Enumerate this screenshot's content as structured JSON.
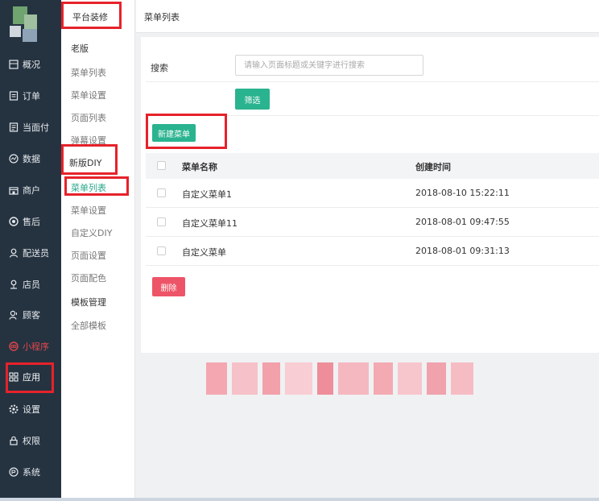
{
  "leftnav": {
    "items": [
      {
        "label": "概况",
        "icon": "overview-icon"
      },
      {
        "label": "订单",
        "icon": "order-icon"
      },
      {
        "label": "当面付",
        "icon": "face-pay-icon"
      },
      {
        "label": "数据",
        "icon": "data-icon"
      },
      {
        "label": "商户",
        "icon": "shop-icon"
      },
      {
        "label": "售后",
        "icon": "after-sales-icon"
      },
      {
        "label": "配送员",
        "icon": "courier-icon"
      },
      {
        "label": "店员",
        "icon": "clerk-icon"
      },
      {
        "label": "顾客",
        "icon": "customer-icon"
      },
      {
        "label": "小程序",
        "icon": "mini-program-icon"
      },
      {
        "label": "应用",
        "icon": "apps-icon"
      },
      {
        "label": "设置",
        "icon": "settings-icon"
      },
      {
        "label": "权限",
        "icon": "permission-icon"
      },
      {
        "label": "系统",
        "icon": "system-icon"
      }
    ]
  },
  "subnav": {
    "header": "平台装修",
    "old_group": "老版",
    "old_items": [
      "菜单列表",
      "菜单设置",
      "页面列表",
      "弹幕设置"
    ],
    "new_group": "新版DIY",
    "new_items": [
      "菜单列表",
      "菜单设置",
      "自定义DIY",
      "页面设置",
      "页面配色"
    ],
    "template_group": "模板管理",
    "template_items": [
      "全部模板"
    ]
  },
  "topbar": {
    "title": "菜单列表"
  },
  "search": {
    "label": "搜索",
    "placeholder": "请输入页面标题或关键字进行搜索",
    "value": ""
  },
  "buttons": {
    "filter": "筛选",
    "new_menu": "新建菜单",
    "delete": "删除"
  },
  "table": {
    "headers": {
      "name": "菜单名称",
      "time": "创建时间"
    },
    "rows": [
      {
        "name": "自定义菜单1",
        "time": "2018-08-10 15:22:11"
      },
      {
        "name": "自定义菜单11",
        "time": "2018-08-01 09:47:55"
      },
      {
        "name": "自定义菜单",
        "time": "2018-08-01 09:31:13"
      }
    ]
  },
  "colors": {
    "sidebar_bg": "#253341",
    "accent_green": "#2ab38f",
    "danger_pink": "#ee5468",
    "highlight_red": "#e6222a"
  }
}
